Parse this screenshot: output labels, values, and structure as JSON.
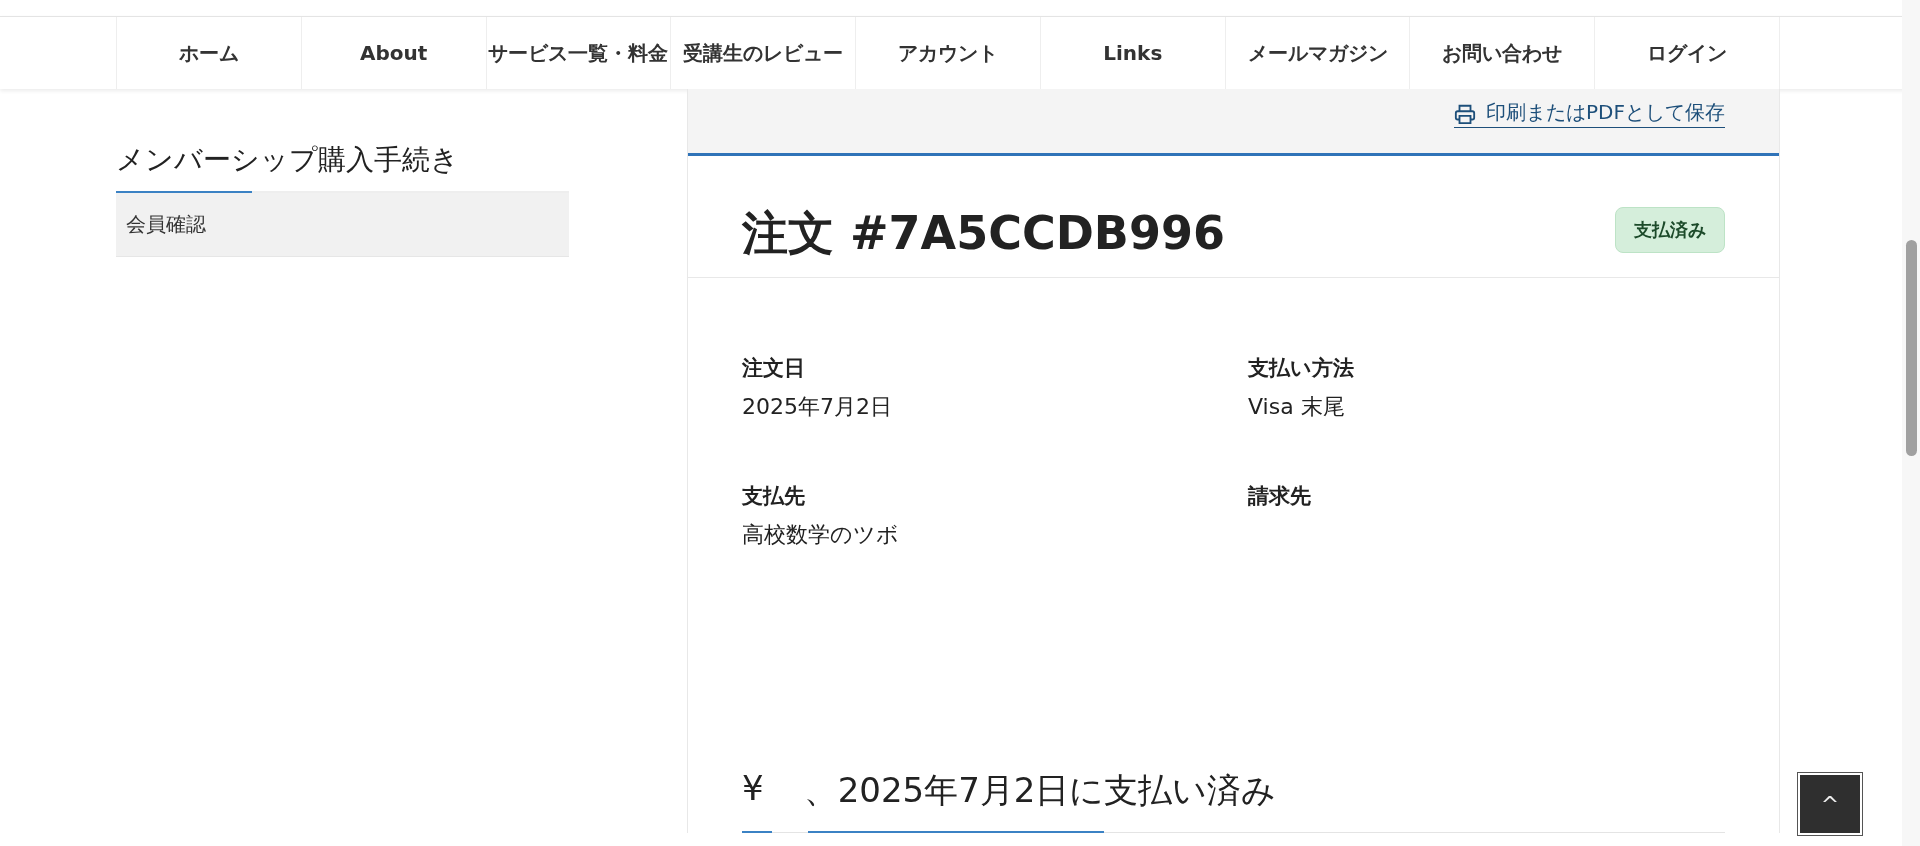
{
  "nav": {
    "items": [
      {
        "label": "ホーム"
      },
      {
        "label": "About"
      },
      {
        "label": "サービス一覧・料金"
      },
      {
        "label": "受講生のレビュー"
      },
      {
        "label": "アカウント"
      },
      {
        "label": "Links"
      },
      {
        "label": "メールマガジン"
      },
      {
        "label": "お問い合わせ"
      },
      {
        "label": "ログイン"
      }
    ]
  },
  "sidebar": {
    "title": "メンバーシップ購入手続き",
    "items": [
      {
        "label": "会員確認",
        "selected": true
      }
    ]
  },
  "order": {
    "print_link": "印刷またはPDFとして保存",
    "title": "注文 #7A5CCDB996",
    "status": "支払済み",
    "fields": [
      {
        "label": "注文日",
        "value": "2025年7月2日"
      },
      {
        "label": "支払い方法",
        "value": "Visa 末尾"
      },
      {
        "label": "支払先",
        "value": "高校数学のツボ"
      },
      {
        "label": "請求先"
      }
    ],
    "summary": {
      "currency": "¥",
      "text": "、2025年7月2日に支払い済み"
    }
  },
  "back_to_top": {
    "icon": "^"
  }
}
